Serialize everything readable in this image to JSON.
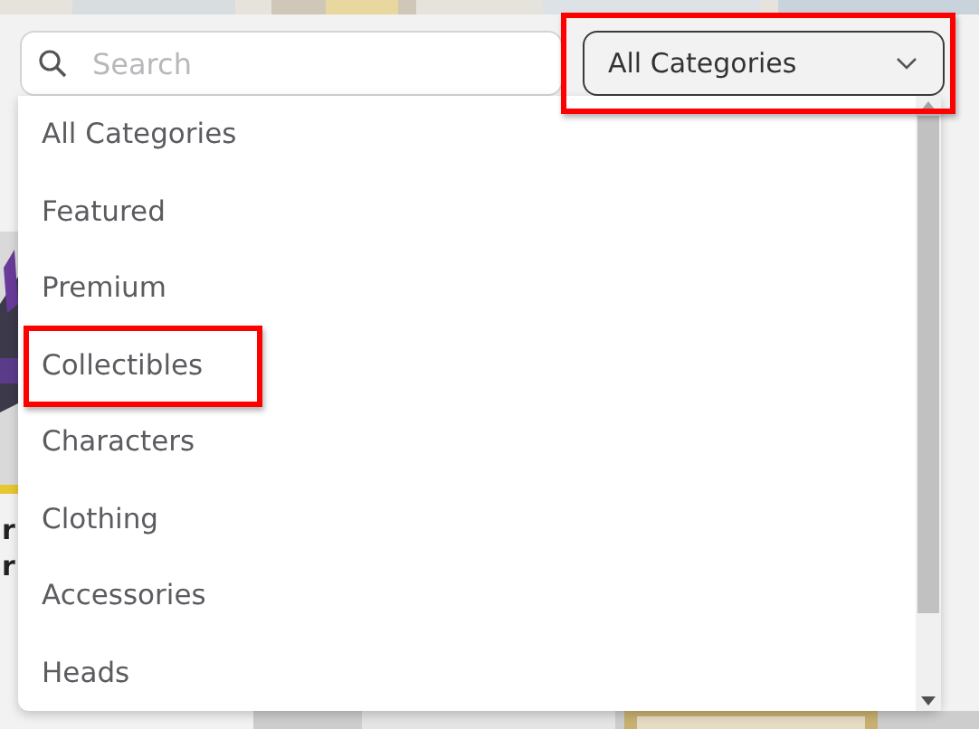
{
  "search": {
    "placeholder": "Search"
  },
  "category_select": {
    "value": "All Categories",
    "highlighted": true
  },
  "menu": {
    "options": [
      {
        "label": "All Categories",
        "highlighted": false
      },
      {
        "label": "Featured",
        "highlighted": false
      },
      {
        "label": "Premium",
        "highlighted": false
      },
      {
        "label": "Collectibles",
        "highlighted": true
      },
      {
        "label": "Characters",
        "highlighted": false
      },
      {
        "label": "Clothing",
        "highlighted": false
      },
      {
        "label": "Accessories",
        "highlighted": false
      },
      {
        "label": "Heads",
        "highlighted": false
      }
    ]
  },
  "background_item": {
    "title_lines": [
      "r",
      "r"
    ]
  }
}
